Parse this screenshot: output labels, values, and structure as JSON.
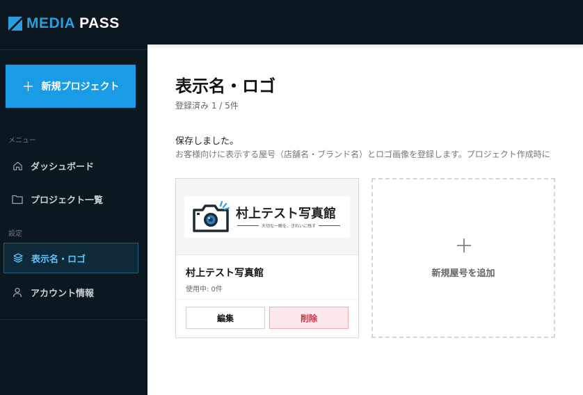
{
  "app": {
    "logo_media": "MEDIA",
    "logo_pass": "PASS"
  },
  "sidebar": {
    "new_project_label": "新規プロジェクト",
    "menu_section": "メニュー",
    "settings_section": "設定",
    "items": [
      {
        "label": "ダッシュボード",
        "icon": "home-icon"
      },
      {
        "label": "プロジェクト一覧",
        "icon": "folder-icon"
      },
      {
        "label": "表示名・ロゴ",
        "icon": "layers-icon",
        "active": true
      },
      {
        "label": "アカウント情報",
        "icon": "user-icon"
      }
    ]
  },
  "main": {
    "title": "表示名・ロゴ",
    "subtitle": "登録済み 1 / 5件",
    "saved_message": "保存しました。",
    "description": "お客様向けに表示する屋号（店舗名・ブランド名）とロゴ画像を登録します。プロジェクト作成時に",
    "cards": [
      {
        "logo_name": "村上テスト写真館",
        "logo_tagline": "大切な一瞬を、きれいに残す",
        "name": "村上テスト写真館",
        "usage": "使用中: 0件",
        "edit_label": "編集",
        "delete_label": "削除"
      }
    ],
    "add_card_label": "新規屋号を追加"
  },
  "colors": {
    "accent": "#1a9be6",
    "sidebar_bg": "#0c1820",
    "active_text": "#5ec4ff",
    "delete_text": "#d02c3e",
    "delete_bg": "#fde9eb"
  }
}
